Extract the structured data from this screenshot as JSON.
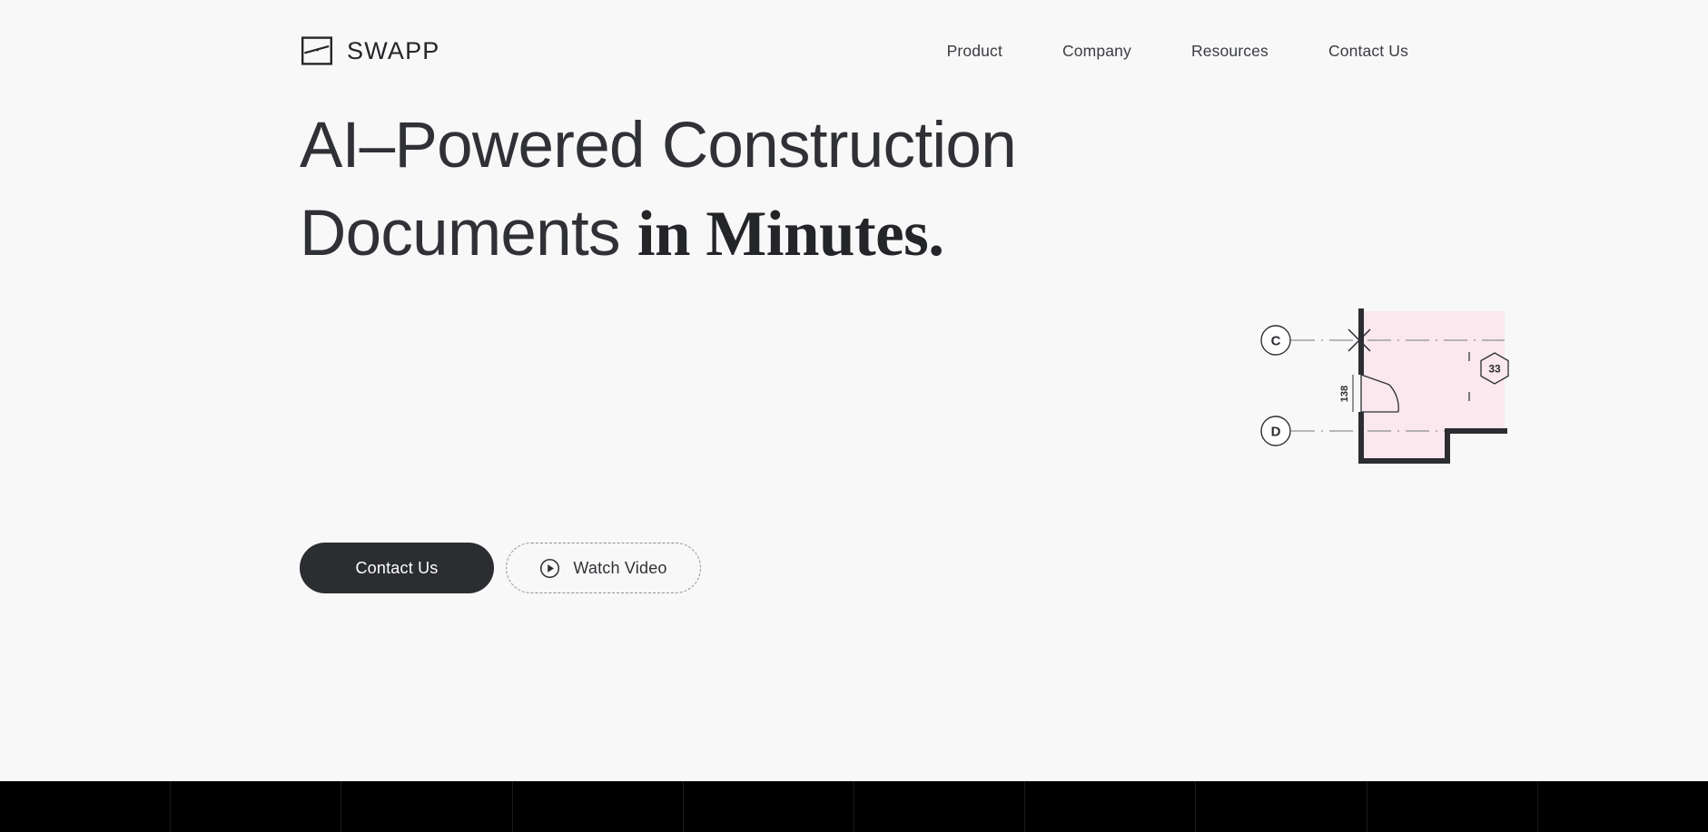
{
  "header": {
    "brand": {
      "name": "SWAPP",
      "logo_icon": "swapp-square-s-logo"
    },
    "nav": [
      {
        "label": "Product"
      },
      {
        "label": "Company"
      },
      {
        "label": "Resources"
      },
      {
        "label": "Contact Us"
      }
    ]
  },
  "hero": {
    "headline": {
      "line1": "AI–Powered Construction",
      "line2_light": "Documents ",
      "line2_accent": "in Minutes."
    },
    "cta": {
      "primary_label": "Contact Us",
      "secondary_label": "Watch Video",
      "secondary_icon": "play-circle-icon"
    }
  },
  "floorplan": {
    "grid_bubbles": [
      {
        "label": "C"
      },
      {
        "label": "D"
      }
    ],
    "dimension_label": "138",
    "room_tag": "33",
    "room_tag_shape": "hexagon",
    "colors": {
      "room_fill": "#fae8ee",
      "wall": "#2b2d31",
      "gridline": "#8d9096"
    }
  },
  "colors": {
    "page_background": "#f8f8f8",
    "text_primary": "#2b2d31",
    "button_primary_bg": "#2b2d31",
    "button_primary_text": "#ffffff",
    "band_background": "#000000"
  }
}
